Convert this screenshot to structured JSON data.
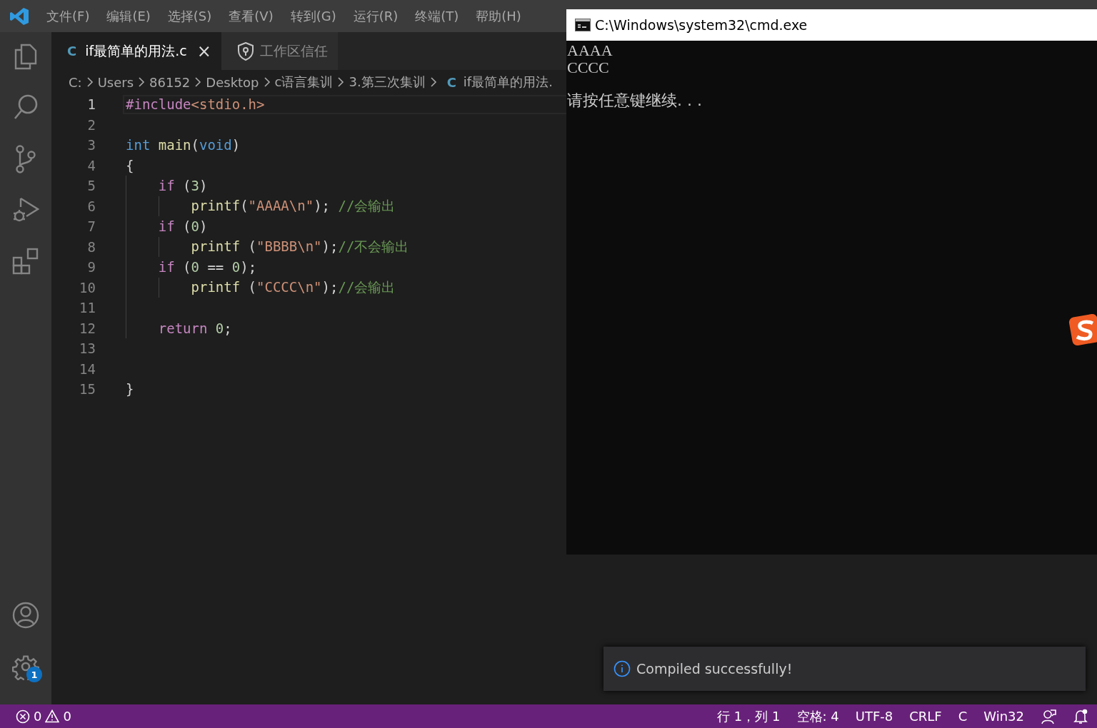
{
  "menu_bar": {
    "items": [
      "文件(F)",
      "编辑(E)",
      "选择(S)",
      "查看(V)",
      "转到(G)",
      "运行(R)",
      "终端(T)",
      "帮助(H)"
    ]
  },
  "activity_bar": {
    "items": [
      {
        "kind": "explorer"
      },
      {
        "kind": "search"
      },
      {
        "kind": "source-control"
      },
      {
        "kind": "run"
      },
      {
        "kind": "extensions"
      }
    ],
    "bottom_items": [
      {
        "kind": "account"
      },
      {
        "kind": "settings",
        "badge": "1"
      }
    ]
  },
  "tabs": [
    {
      "kind": "c-file",
      "icon_text": "C",
      "label": "if最简单的用法.c",
      "close": "×",
      "selected": true
    },
    {
      "kind": "trust",
      "label": "工作区信任",
      "selected": false
    }
  ],
  "breadcrumb": [
    {
      "label": "C:"
    },
    {
      "label": "Users"
    },
    {
      "label": "86152"
    },
    {
      "label": "Desktop"
    },
    {
      "label": "c语言集训"
    },
    {
      "label": "3.第三次集训"
    },
    {
      "icon_text": "C",
      "label": "if最简单的用法."
    }
  ],
  "editor": {
    "lines": [
      {
        "number": "1",
        "current": true,
        "tokens": [
          {
            "kind": "control",
            "text": "#include"
          },
          {
            "kind": "string",
            "text": "<stdio.h>"
          }
        ]
      },
      {
        "number": "2",
        "current": false
      },
      {
        "number": "3",
        "current": false,
        "tokens": [
          {
            "kind": "keyword",
            "text": "int"
          },
          {
            "kind": "function",
            "text": " main"
          },
          {
            "kind": "plain",
            "text": "("
          },
          {
            "kind": "keyword",
            "text": "void"
          },
          {
            "kind": "plain",
            "text": ")"
          }
        ]
      },
      {
        "number": "4",
        "current": false,
        "tokens": [
          {
            "kind": "plain",
            "text": "{"
          }
        ]
      },
      {
        "number": "5",
        "current": false,
        "tokens": [
          {
            "kind": "control",
            "text": "    if"
          },
          {
            "kind": "plain",
            "text": " ("
          },
          {
            "kind": "number",
            "text": "3"
          },
          {
            "kind": "plain",
            "text": ")"
          }
        ]
      },
      {
        "number": "6",
        "current": false,
        "tokens": [
          {
            "kind": "function",
            "text": "        printf"
          },
          {
            "kind": "plain",
            "text": "("
          },
          {
            "kind": "string",
            "text": "\"AAAA\\n\""
          },
          {
            "kind": "plain",
            "text": ");"
          },
          {
            "kind": "comment",
            "text": " //会输出"
          }
        ]
      },
      {
        "number": "7",
        "current": false,
        "tokens": [
          {
            "kind": "control",
            "text": "    if"
          },
          {
            "kind": "plain",
            "text": " ("
          },
          {
            "kind": "number",
            "text": "0"
          },
          {
            "kind": "plain",
            "text": ")"
          }
        ]
      },
      {
        "number": "8",
        "current": false,
        "tokens": [
          {
            "kind": "function",
            "text": "        printf"
          },
          {
            "kind": "plain",
            "text": " ("
          },
          {
            "kind": "string",
            "text": "\"BBBB\\n\""
          },
          {
            "kind": "plain",
            "text": ");"
          },
          {
            "kind": "comment",
            "text": "//不会输出"
          }
        ]
      },
      {
        "number": "9",
        "current": false,
        "tokens": [
          {
            "kind": "control",
            "text": "    if"
          },
          {
            "kind": "plain",
            "text": " ("
          },
          {
            "kind": "number",
            "text": "0"
          },
          {
            "kind": "plain",
            "text": " =="
          },
          {
            "kind": "number",
            "text": " 0"
          },
          {
            "kind": "plain",
            "text": ");"
          }
        ]
      },
      {
        "number": "10",
        "current": false,
        "tokens": [
          {
            "kind": "function",
            "text": "        printf"
          },
          {
            "kind": "plain",
            "text": " ("
          },
          {
            "kind": "string",
            "text": "\"CCCC\\n\""
          },
          {
            "kind": "plain",
            "text": ");"
          },
          {
            "kind": "comment",
            "text": "//会输出"
          }
        ]
      },
      {
        "number": "11",
        "current": false
      },
      {
        "number": "12",
        "current": false,
        "tokens": [
          {
            "kind": "control",
            "text": "    return"
          },
          {
            "kind": "number",
            "text": " 0"
          },
          {
            "kind": "plain",
            "text": ";"
          }
        ]
      },
      {
        "number": "13",
        "current": false
      },
      {
        "number": "14",
        "current": false
      },
      {
        "number": "15",
        "current": false,
        "tokens": [
          {
            "kind": "plain",
            "text": "}"
          }
        ]
      }
    ]
  },
  "console_window": {
    "title": "C:\\Windows\\system32\\cmd.exe",
    "output": [
      "AAAA",
      "CCCC"
    ],
    "prompt": "请按任意键继续. . ."
  },
  "notification": {
    "message": "Compiled successfully!"
  },
  "status_bar": {
    "errors": "0",
    "warnings": "0",
    "items": [
      "行 1，列 1",
      "空格: 4",
      "UTF-8",
      "CRLF",
      "C",
      "Win32"
    ]
  }
}
